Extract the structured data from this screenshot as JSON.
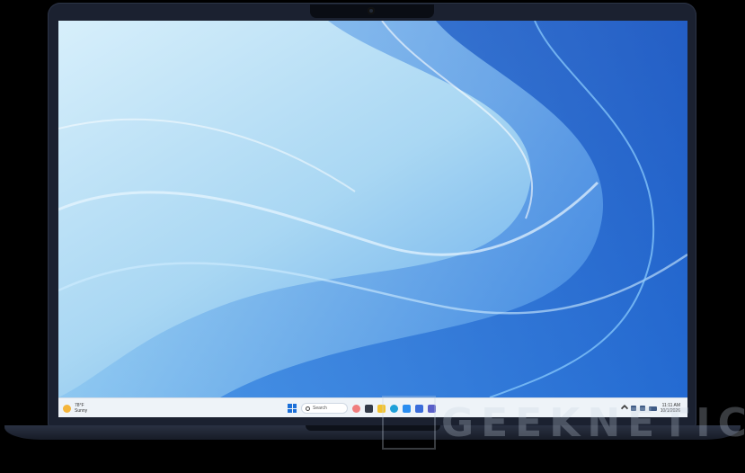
{
  "taskbar": {
    "weather": {
      "temperature": "78°F",
      "condition": "Sunny",
      "icon": "sun-icon"
    },
    "search_label": "Search",
    "pinned_apps": [
      {
        "name": "copilot-icon",
        "color": "#f07e7e"
      },
      {
        "name": "task-view-icon",
        "color": "#333a48"
      },
      {
        "name": "file-explorer-icon",
        "color": "#f2c230"
      },
      {
        "name": "edge-icon",
        "color": "#1fa0d8"
      },
      {
        "name": "store-icon",
        "color": "#2a8df0"
      },
      {
        "name": "mail-icon",
        "color": "#3a6ddb"
      },
      {
        "name": "teams-icon",
        "color": "#5a5fc8"
      }
    ],
    "clock": {
      "time": "11:11 AM",
      "date": "10/1/2026"
    }
  },
  "watermark": {
    "text": "GEEKNETIC"
  },
  "colors": {
    "bezel": "#1b2130",
    "wallpaper_light": "#cfeaf8",
    "wallpaper_deep": "#1556c9"
  }
}
